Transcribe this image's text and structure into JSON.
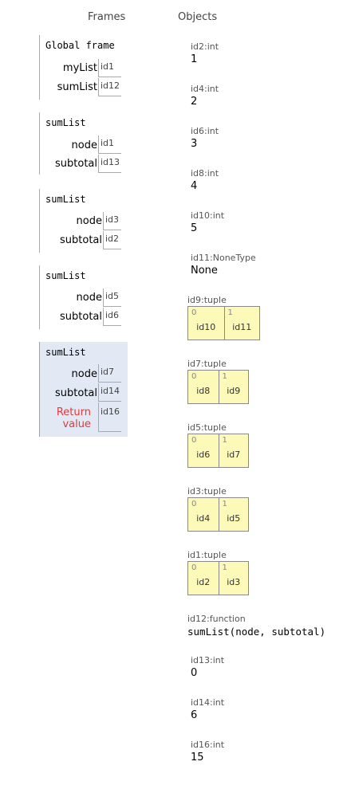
{
  "headers": {
    "frames": "Frames",
    "objects": "Objects"
  },
  "frames": [
    {
      "name": "Global frame",
      "vars": [
        {
          "name": "myList",
          "ref": "id1"
        },
        {
          "name": "sumList",
          "ref": "id12"
        }
      ]
    },
    {
      "name": "sumList",
      "vars": [
        {
          "name": "node",
          "ref": "id1"
        },
        {
          "name": "subtotal",
          "ref": "id13"
        }
      ]
    },
    {
      "name": "sumList",
      "vars": [
        {
          "name": "node",
          "ref": "id3"
        },
        {
          "name": "subtotal",
          "ref": "id2"
        }
      ]
    },
    {
      "name": "sumList",
      "vars": [
        {
          "name": "node",
          "ref": "id5"
        },
        {
          "name": "subtotal",
          "ref": "id6"
        }
      ]
    },
    {
      "name": "sumList",
      "active": true,
      "vars": [
        {
          "name": "node",
          "ref": "id7"
        },
        {
          "name": "subtotal",
          "ref": "id14"
        },
        {
          "name": "Return\nvalue",
          "ref": "id16",
          "is_return": true
        }
      ]
    }
  ],
  "objects": [
    {
      "label": "id2:int",
      "value": "1"
    },
    {
      "label": "id4:int",
      "value": "2"
    },
    {
      "label": "id6:int",
      "value": "3"
    },
    {
      "label": "id8:int",
      "value": "4"
    },
    {
      "label": "id10:int",
      "value": "5"
    },
    {
      "label": "id11:NoneType",
      "value": "None"
    },
    {
      "label": "id9:tuple",
      "tuple": [
        {
          "index": "0",
          "value": "id10"
        },
        {
          "index": "1",
          "value": "id11"
        }
      ]
    },
    {
      "label": "id7:tuple",
      "tuple": [
        {
          "index": "0",
          "value": "id8"
        },
        {
          "index": "1",
          "value": "id9"
        }
      ]
    },
    {
      "label": "id5:tuple",
      "tuple": [
        {
          "index": "0",
          "value": "id6"
        },
        {
          "index": "1",
          "value": "id7"
        }
      ]
    },
    {
      "label": "id3:tuple",
      "tuple": [
        {
          "index": "0",
          "value": "id4"
        },
        {
          "index": "1",
          "value": "id5"
        }
      ]
    },
    {
      "label": "id1:tuple",
      "tuple": [
        {
          "index": "0",
          "value": "id2"
        },
        {
          "index": "1",
          "value": "id3"
        }
      ]
    },
    {
      "label": "id12:function",
      "value": "sumList(node, subtotal)",
      "mono": true
    },
    {
      "label": "id13:int",
      "value": "0"
    },
    {
      "label": "id14:int",
      "value": "6"
    },
    {
      "label": "id16:int",
      "value": "15"
    }
  ],
  "colors": {
    "active_frame_bg": "#e2e8f4",
    "tuple_bg": "#fdf9b9",
    "return_label": "#e03a3a"
  }
}
